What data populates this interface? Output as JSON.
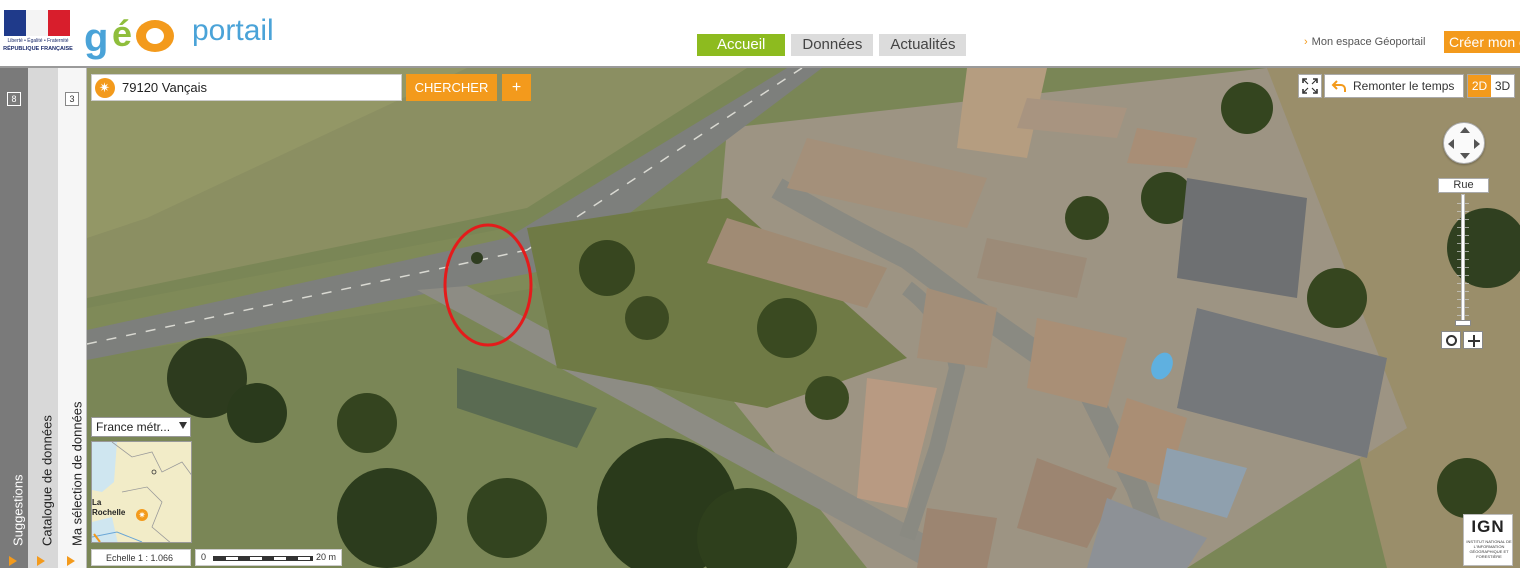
{
  "header": {
    "republic_motto": "Liberté • Égalité • Fraternité",
    "republic_name": "RÉPUBLIQUE FRANÇAISE",
    "brand_g": "g",
    "brand_e": "é",
    "brand_portail": "portail",
    "nav_tabs": [
      {
        "label": "Accueil",
        "active": true
      },
      {
        "label": "Données",
        "active": false
      },
      {
        "label": "Actualités",
        "active": false
      }
    ],
    "user_link": "Mon espace Géoportail",
    "create_account_label": "Créer mon e"
  },
  "sidebar": {
    "suggestions": {
      "label": "Suggestions",
      "count": "8"
    },
    "catalog": {
      "label": "Catalogue de données"
    },
    "selection": {
      "label": "Ma sélection de données",
      "count": "3"
    }
  },
  "map": {
    "search": {
      "value": "79120 Vançais",
      "button_label": "CHERCHER",
      "add_label": "+"
    },
    "history_label": "Remonter le temps",
    "dimension_toggle": {
      "options": [
        "2D",
        "3D"
      ],
      "active": "2D"
    },
    "zoom": {
      "level_label": "Rue"
    },
    "territory_select": "France métr...",
    "overview": {
      "city_label": "La\nRochelle"
    },
    "scale": {
      "ratio_label": "Echelle 1 :  1.066",
      "bar_start": "0",
      "bar_end": "20 m"
    },
    "attribution": {
      "logo_text": "IGN",
      "subtitle": "INSTITUT NATIONAL DE L'INFORMATION GÉOGRAPHIQUE ET FORESTIÈRE"
    }
  },
  "colors": {
    "accent_orange": "#f39a1c",
    "nav_active_green": "#8dbb1f",
    "brand_blue": "#4aa3d8",
    "annotation_red": "#e41b1b"
  }
}
